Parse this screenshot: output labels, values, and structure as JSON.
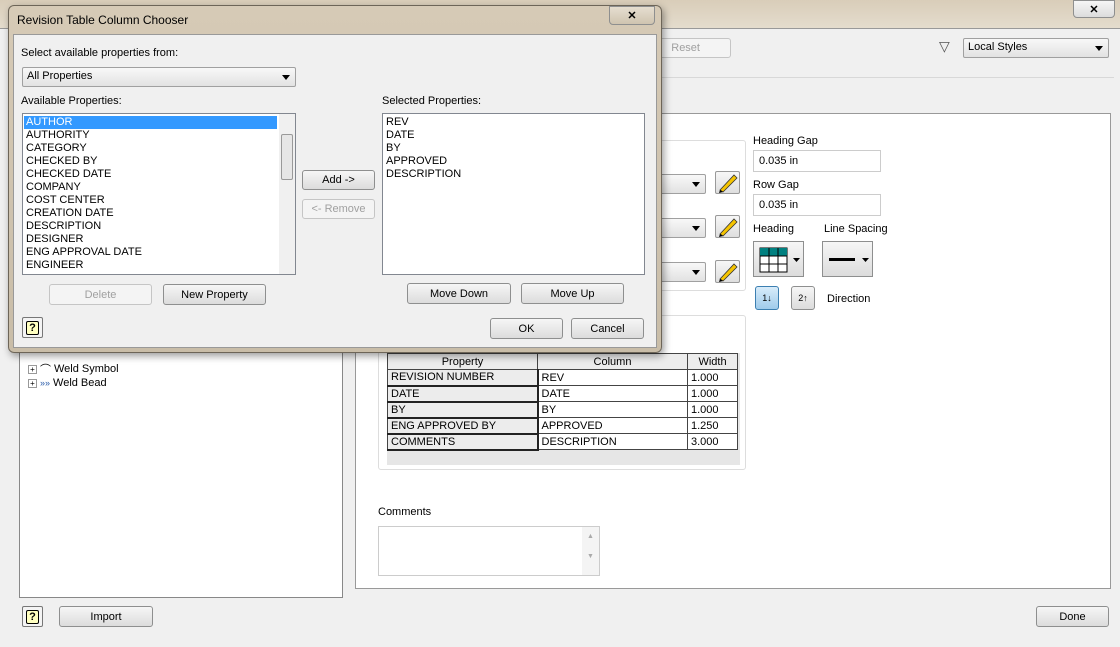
{
  "main": {
    "reset_label": "Reset",
    "style_filter": "Local Styles",
    "heading_gap_label": "Heading Gap",
    "heading_gap_value": "0.035 in",
    "row_gap_label": "Row Gap",
    "row_gap_value": "0.035 in",
    "heading_label": "Heading",
    "line_spacing_label": "Line Spacing",
    "direction_label": "Direction",
    "table": {
      "headers": [
        "Property",
        "Column",
        "Width"
      ],
      "rows": [
        [
          "REVISION NUMBER",
          "REV",
          "1.000"
        ],
        [
          "DATE",
          "DATE",
          "1.000"
        ],
        [
          "BY",
          "BY",
          "1.000"
        ],
        [
          "ENG APPROVED BY",
          "APPROVED",
          "1.250"
        ],
        [
          "COMMENTS",
          "DESCRIPTION",
          "3.000"
        ]
      ]
    },
    "comments_label": "Comments",
    "comments_value": "",
    "tree": [
      {
        "label": "Weld Symbol"
      },
      {
        "label": "Weld Bead"
      }
    ],
    "import_label": "Import",
    "done_label": "Done"
  },
  "dialog": {
    "title": "Revision Table Column Chooser",
    "source_label": "Select available properties from:",
    "source_value": "All Properties",
    "available_label": "Available Properties:",
    "available": [
      "AUTHOR",
      "AUTHORITY",
      "CATEGORY",
      "CHECKED BY",
      "CHECKED DATE",
      "COMPANY",
      "COST CENTER",
      "CREATION DATE",
      "DESCRIPTION",
      "DESIGNER",
      "ENG APPROVAL DATE",
      "ENGINEER"
    ],
    "selected_available": "AUTHOR",
    "selected_label": "Selected Properties:",
    "selected": [
      "REV",
      "DATE",
      "BY",
      "APPROVED",
      "DESCRIPTION"
    ],
    "add_label": "Add ->",
    "remove_label": "<- Remove",
    "delete_label": "Delete",
    "new_property_label": "New Property",
    "move_down_label": "Move Down",
    "move_up_label": "Move Up",
    "ok_label": "OK",
    "cancel_label": "Cancel",
    "help_label": "?"
  }
}
